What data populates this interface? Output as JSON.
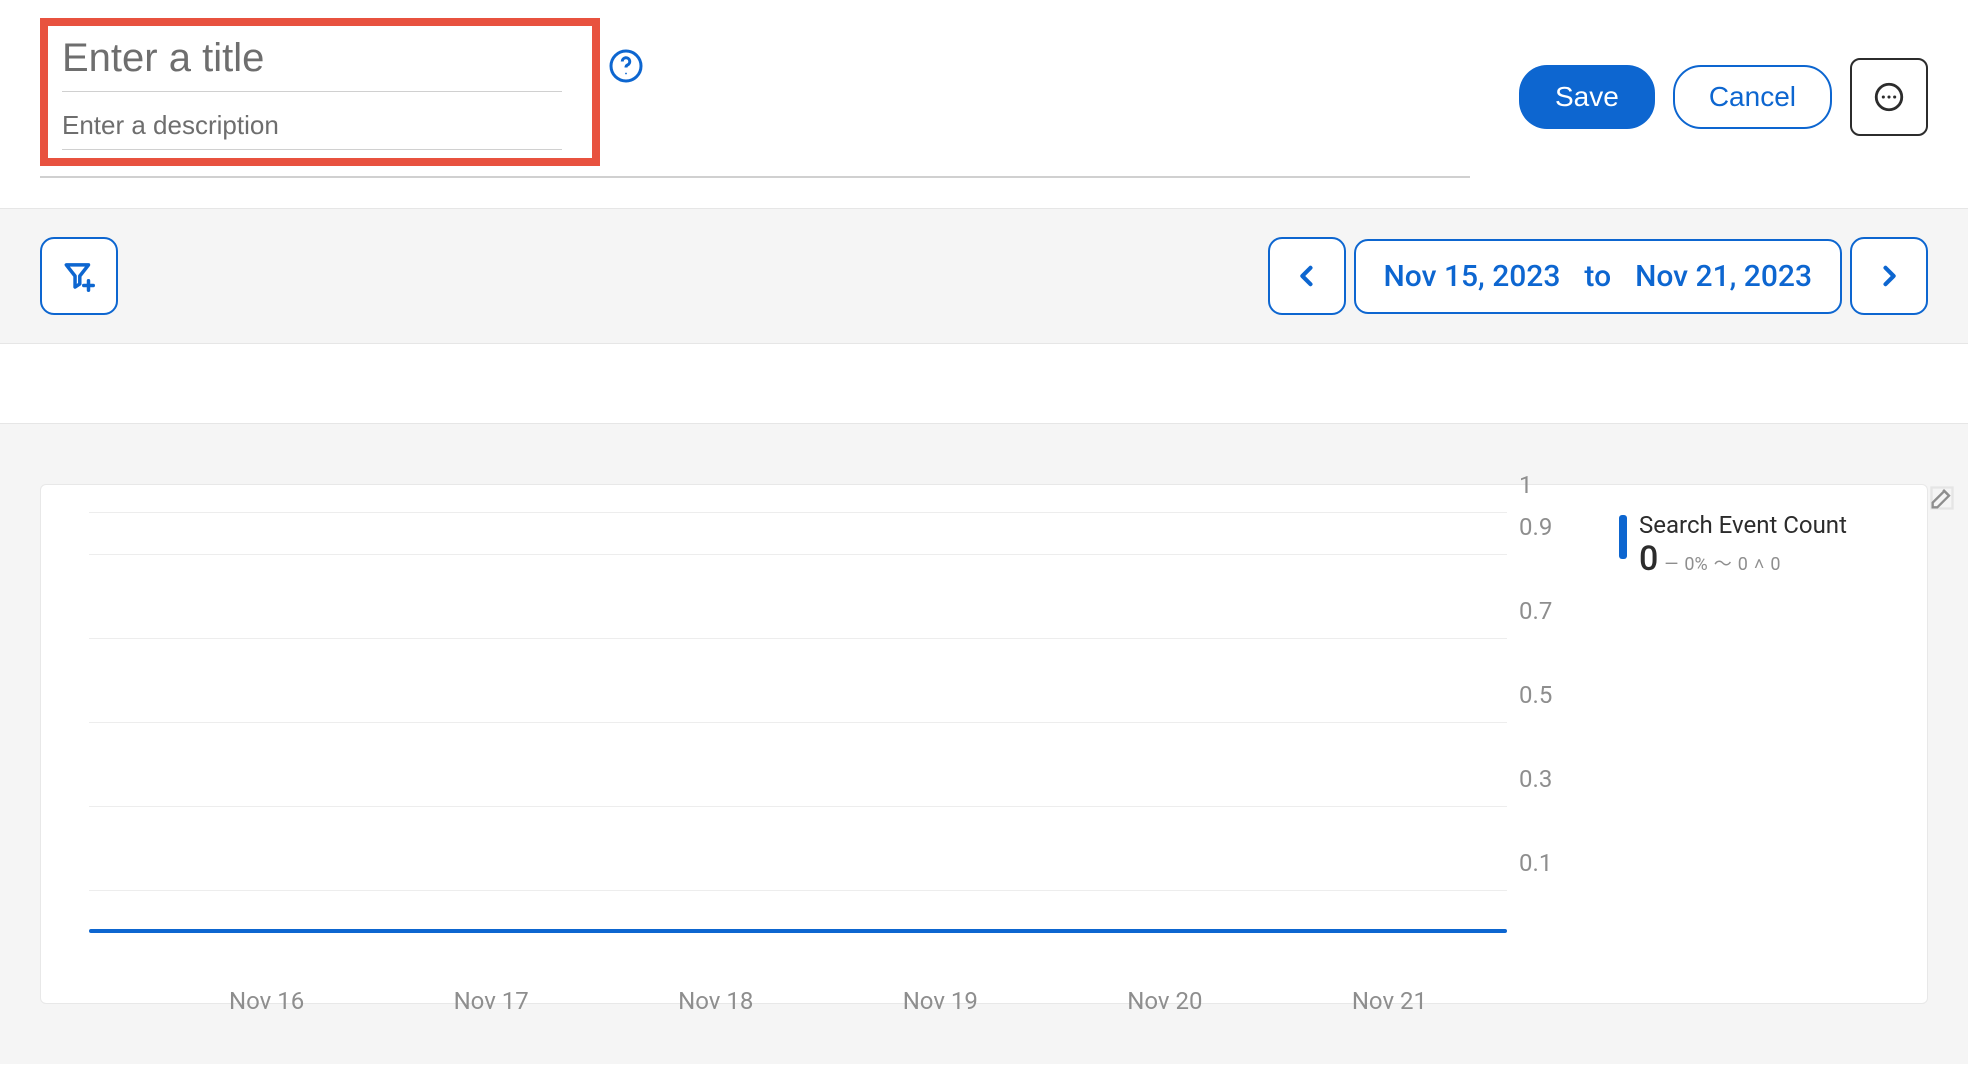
{
  "header": {
    "title_placeholder": "Enter a title",
    "description_placeholder": "Enter a description",
    "save_label": "Save",
    "cancel_label": "Cancel"
  },
  "toolbar": {
    "date_from": "Nov 15, 2023",
    "date_to_word": "to",
    "date_to": "Nov 21, 2023"
  },
  "chart_data": {
    "type": "line",
    "title": "",
    "xlabel": "",
    "ylabel": "",
    "ylim": [
      0,
      1
    ],
    "y_ticks": [
      1,
      0.9,
      0.7,
      0.5,
      0.3,
      0.1
    ],
    "categories": [
      "Nov 16",
      "Nov 17",
      "Nov 18",
      "Nov 19",
      "Nov 20",
      "Nov 21"
    ],
    "series": [
      {
        "name": "Search Event Count",
        "values": [
          0,
          0,
          0,
          0,
          0,
          0
        ]
      }
    ],
    "legend": {
      "series_name": "Search Event Count",
      "total": "0",
      "pct": "0%",
      "avg": "0",
      "peak": "0"
    }
  }
}
